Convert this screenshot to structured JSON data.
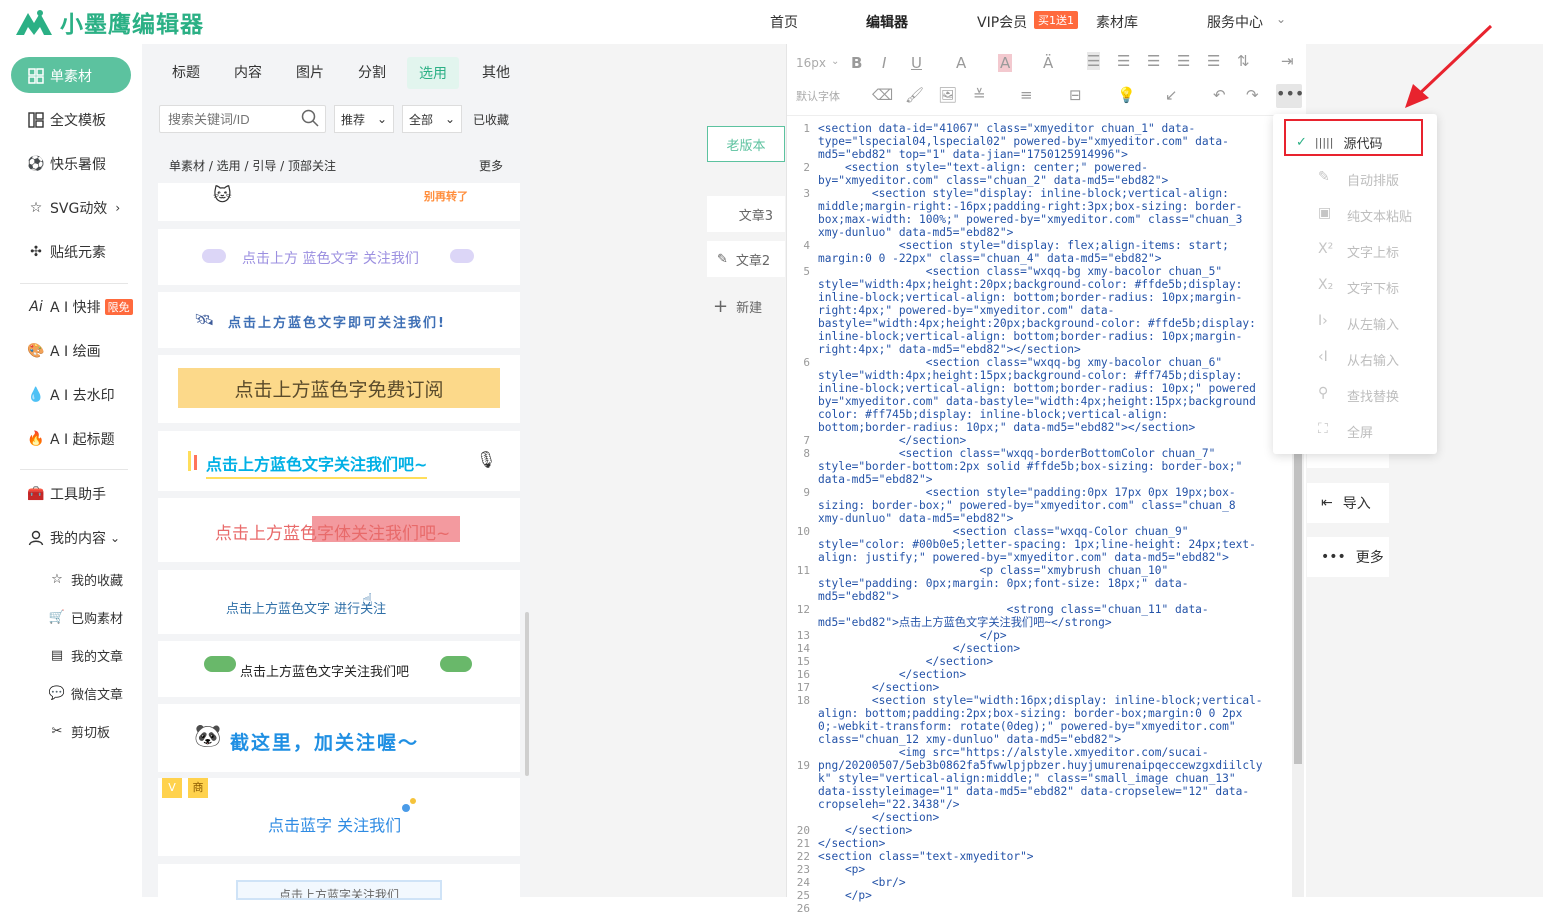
{
  "app": {
    "title": "小墨鹰编辑器"
  },
  "topnav": {
    "home": "首页",
    "editor": "编辑器",
    "vip": "VIP会员",
    "vip_badge": "买1送1",
    "materials": "素材库",
    "service": "服务中心"
  },
  "leftnav": {
    "items": [
      {
        "label": "单素材"
      },
      {
        "label": "全文模板"
      },
      {
        "label": "快乐暑假"
      },
      {
        "label": "SVG动效"
      },
      {
        "label": "贴纸元素"
      },
      {
        "label": "A I 快排"
      },
      {
        "label": "A I 绘画"
      },
      {
        "label": "A I 去水印"
      },
      {
        "label": "A I 起标题"
      },
      {
        "label": "工具助手"
      },
      {
        "label": "我的内容"
      },
      {
        "label": "我的收藏"
      },
      {
        "label": "已购素材"
      },
      {
        "label": "我的文章"
      },
      {
        "label": "微信文章"
      },
      {
        "label": "剪切板"
      }
    ],
    "limited_badge": "限免"
  },
  "panel": {
    "tabs": [
      "标题",
      "内容",
      "图片",
      "分割",
      "选用",
      "其他"
    ],
    "search_placeholder": "搜索关键词/ID",
    "filter_sort": "推荐",
    "filter_scope": "全部",
    "collected": "已收藏",
    "breadcrumb": "单素材 / 选用 / 引导 / 顶部关注",
    "more": "更多",
    "cards": [
      {
        "text": "别再转了"
      },
      {
        "text": "点击上方 蓝色文字 关注我们"
      },
      {
        "text": "点击上方蓝色文字即可关注我们!"
      },
      {
        "text": "点击上方蓝色字免费订阅"
      },
      {
        "text": "点击上方蓝色文字关注我们吧~"
      },
      {
        "text": "点击上方蓝色字体关注我们吧~"
      },
      {
        "text": "点击上方蓝色文字    进行关注"
      },
      {
        "text": "点击上方蓝色文字关注我们吧"
      },
      {
        "text": "截这里，加关注喔～"
      },
      {
        "text": "点击蓝字 关注我们"
      },
      {
        "text": "点击上方蓝字关注我们"
      }
    ]
  },
  "midcol": {
    "old_version": "老版本",
    "article3": "文章3",
    "article2": "文章2",
    "new": "新建"
  },
  "toolbar": {
    "font_size": "16px",
    "font_family": "默认字体"
  },
  "code": {
    "line_numbers": [
      "1",
      "2",
      "3",
      "4",
      "5",
      "6",
      "7",
      "8",
      "9",
      "10",
      "11",
      "12",
      "13",
      "14",
      "15",
      "16",
      "17",
      "18",
      "19",
      "20",
      "21",
      "22",
      "23",
      "24",
      "25",
      "26"
    ],
    "lines": [
      "<section data-id=\"41067\" class=\"xmyeditor chuan_1\" data-",
      "type=\"lspecial04,lspecial02\" powered-by=\"xmyeditor.com\" data-",
      "md5=\"ebd82\" top=\"1\" data-jian=\"1750125914996\">",
      "    <section style=\"text-align: center;\" powered-",
      "by=\"xmyeditor.com\" class=\"chuan_2\" data-md5=\"ebd82\">",
      "        <section style=\"display: inline-block;vertical-align:",
      "middle;margin-right:-16px;padding-right:3px;box-sizing: border-",
      "box;max-width: 100%;\" powered-by=\"xmyeditor.com\" class=\"chuan_3",
      "xmy-dunluo\" data-md5=\"ebd82\">",
      "            <section style=\"display: flex;align-items: start;",
      "margin:0 0 -22px\" class=\"chuan_4\" data-md5=\"ebd82\">",
      "                <section class=\"wxqq-bg xmy-bacolor chuan_5\"",
      "style=\"width:4px;height:20px;background-color: #ffde5b;display:",
      "inline-block;vertical-align: bottom;border-radius: 10px;margin-",
      "right:4px;\" powered-by=\"xmyeditor.com\" data-",
      "bastyle=\"width:4px;height:20px;background-color: #ffde5b;display:",
      "inline-block;vertical-align: bottom;border-radius: 10px;margin-",
      "right:4px;\" data-md5=\"ebd82\"></section>",
      "                <section class=\"wxqq-bg xmy-bacolor chuan_6\"",
      "style=\"width:4px;height:15px;background-color: #ff745b;display:",
      "inline-block;vertical-align: bottom;border-radius: 10px;\" powered",
      "by=\"xmyeditor.com\" data-bastyle=\"width:4px;height:15px;background",
      "color: #ff745b;display: inline-block;vertical-align:",
      "bottom;border-radius: 10px;\" data-md5=\"ebd82\"></section>",
      "            </section>",
      "            <section class=\"wxqq-borderBottomColor chuan_7\"",
      "style=\"border-bottom:2px solid #ffde5b;box-sizing: border-box;\"",
      "data-md5=\"ebd82\">",
      "                <section style=\"padding:0px 17px 0px 19px;box-",
      "sizing: border-box;\" powered-by=\"xmyeditor.com\" class=\"chuan_8",
      "xmy-dunluo\" data-md5=\"ebd82\">",
      "                    <section class=\"wxqq-Color chuan_9\"",
      "style=\"color: #00b0e5;letter-spacing: 1px;line-height: 24px;text-",
      "align: justify;\" powered-by=\"xmyeditor.com\" data-md5=\"ebd82\">",
      "                        <p class=\"xmybrush chuan_10\"",
      "style=\"padding: 0px;margin: 0px;font-size: 18px;\" data-",
      "md5=\"ebd82\">",
      "                            <strong class=\"chuan_11\" data-",
      "md5=\"ebd82\">点击上方蓝色文字关注我们吧~</strong>",
      "                        </p>",
      "                    </section>",
      "                </section>",
      "            </section>",
      "        </section>",
      "        <section style=\"width:16px;display: inline-block;vertical-",
      "align: bottom;padding:2px;box-sizing: border-box;margin:0 0 2px",
      "0;-webkit-transform: rotate(0deg);\" powered-by=\"xmyeditor.com\"",
      "class=\"chuan_12 xmy-dunluo\" data-md5=\"ebd82\">",
      "            <img src=\"https://alstyle.xmyeditor.com/sucai-",
      "png/20200507/5eb3b0862fa5fwwlpjpbzer.huyjumurenaipqeccewzgxdiilcly",
      "k\" style=\"vertical-align:middle;\" class=\"small_image chuan_13\"",
      "data-isstyleimage=\"1\" data-md5=\"ebd82\" data-cropselew=\"12\" data-",
      "cropseleh=\"22.3438\"/>",
      "        </section>",
      "    </section>",
      "</section>",
      "<section class=\"text-xmyeditor\">",
      "    <p>",
      "        <br/>",
      "    </p>"
    ]
  },
  "rightcol": {
    "import": "导入",
    "more": "更多"
  },
  "dropdown": {
    "items": [
      {
        "label": "源代码"
      },
      {
        "label": "自动排版"
      },
      {
        "label": "纯文本粘贴"
      },
      {
        "label": "文字上标"
      },
      {
        "label": "文字下标"
      },
      {
        "label": "从左输入"
      },
      {
        "label": "从右输入"
      },
      {
        "label": "查找替换"
      },
      {
        "label": "全屏"
      }
    ]
  },
  "colors": {
    "brand": "#2bb085",
    "highlight_red": "#e8232e",
    "code_blue": "#2453a8"
  }
}
